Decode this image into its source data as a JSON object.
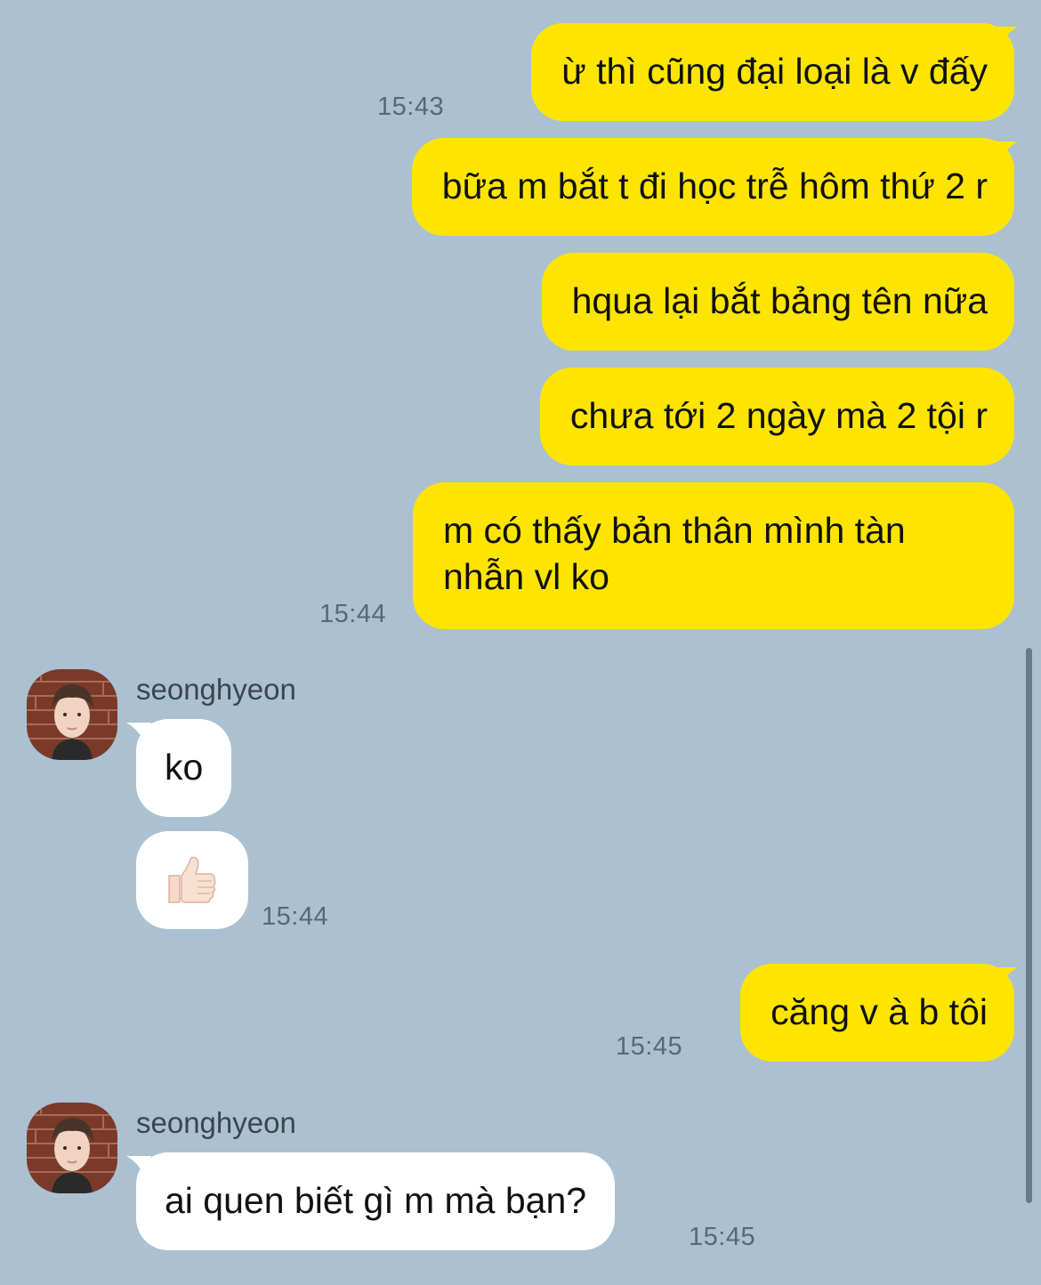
{
  "messages": [
    {
      "text": "ừ thì cũng đại loại là v đấy",
      "time": "15:43"
    },
    {
      "text": "bữa m bắt t đi học trễ hôm thứ 2 r"
    },
    {
      "text": "hqua lại bắt bảng tên nữa"
    },
    {
      "text": "chưa tới 2 ngày mà 2 tội r"
    },
    {
      "text": "m có thấy bản thân mình tàn nhẫn vl ko",
      "time": "15:44"
    }
  ],
  "reply_group_1": {
    "sender": "seonghyeon",
    "text": "ko",
    "sticker_icon": "thumbs-up-emoji",
    "time": "15:44"
  },
  "my_message_2": {
    "text": "căng v à b tôi",
    "time": "15:45"
  },
  "reply_group_2": {
    "sender": "seonghyeon",
    "text": "ai quen biết gì m mà bạn?",
    "time": "15:45"
  },
  "colors": {
    "background": "#abc1d1",
    "my_bubble": "#fee500",
    "their_bubble": "#ffffff"
  }
}
